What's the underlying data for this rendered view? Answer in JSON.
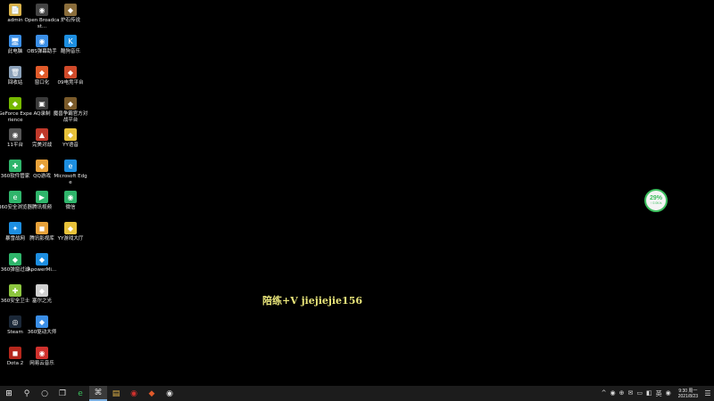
{
  "desktop": {
    "columns": [
      [
        {
          "name": "admin",
          "glyph": "📄",
          "color": "#d9b24a"
        },
        {
          "name": "此电脑",
          "glyph": "🖥",
          "color": "#3a8ee6"
        },
        {
          "name": "回收站",
          "glyph": "🗑",
          "color": "#8aa0b8"
        },
        {
          "name": "GeForce Experience",
          "glyph": "◆",
          "color": "#76b900"
        },
        {
          "name": "11平台",
          "glyph": "◉",
          "color": "#555555"
        },
        {
          "name": "360软件管家",
          "glyph": "✚",
          "color": "#2fb56b"
        },
        {
          "name": "360安全浏览器",
          "glyph": "e",
          "color": "#2fb56b"
        },
        {
          "name": "暴雪战网",
          "glyph": "✦",
          "color": "#1d8ee0"
        },
        {
          "name": "360弹窗过滤",
          "glyph": "◆",
          "color": "#2fb56b"
        },
        {
          "name": "360安全卫士",
          "glyph": "✚",
          "color": "#8cc63f"
        },
        {
          "name": "Steam",
          "glyph": "◎",
          "color": "#1b2838"
        },
        {
          "name": "Dota 2",
          "glyph": "◼",
          "color": "#b5271c"
        }
      ],
      [
        {
          "name": "Open Broadcast...",
          "glyph": "◉",
          "color": "#444444"
        },
        {
          "name": "OBS弹幕助手",
          "glyph": "◉",
          "color": "#3a8ee6"
        },
        {
          "name": "窗口化",
          "glyph": "◆",
          "color": "#e05a2a"
        },
        {
          "name": "AQ录制",
          "glyph": "▣",
          "color": "#3a3a3a"
        },
        {
          "name": "完美对战",
          "glyph": "▲",
          "color": "#c0392b"
        },
        {
          "name": "QQ游戏",
          "glyph": "◆",
          "color": "#e8a23a"
        },
        {
          "name": "腾讯视频",
          "glyph": "▶",
          "color": "#2fb56b"
        },
        {
          "name": "腾讯影视库",
          "glyph": "◼",
          "color": "#e8a23a"
        },
        {
          "name": "ApowerMi...",
          "glyph": "◆",
          "color": "#1d8ee0"
        },
        {
          "name": "塞尔之光",
          "glyph": "◆",
          "color": "#d0d0d0"
        },
        {
          "name": "360驱动大师",
          "glyph": "◆",
          "color": "#3a8ee6"
        },
        {
          "name": "网易云音乐",
          "glyph": "◉",
          "color": "#d0312d"
        }
      ],
      [
        {
          "name": "炉石传说",
          "glyph": "◆",
          "color": "#8a6d3b"
        },
        {
          "name": "酷狗音乐",
          "glyph": "K",
          "color": "#1d8ee0"
        },
        {
          "name": "09电竞平台",
          "glyph": "◆",
          "color": "#d04a2a"
        },
        {
          "name": "魔兽争霸官方对战平台",
          "glyph": "◆",
          "color": "#7a5a2a"
        },
        {
          "name": "YY语音",
          "glyph": "◆",
          "color": "#e8c23a"
        },
        {
          "name": "Microsoft Edge",
          "glyph": "e",
          "color": "#1d8ee0"
        },
        {
          "name": "微信",
          "glyph": "◉",
          "color": "#2fb56b"
        },
        {
          "name": "YY游戏大厅",
          "glyph": "◆",
          "color": "#e8c23a"
        }
      ]
    ]
  },
  "watermark": "陪练+V  jiejiejie156",
  "netmeter": {
    "percent": "29%",
    "speed": "↑ 0.0K/s"
  },
  "taskbar": {
    "start_glyph": "⊞",
    "search_glyph": "⚲",
    "cortana_glyph": "○",
    "taskview_glyph": "❐",
    "apps": [
      {
        "name": "360安全浏览器",
        "glyph": "e",
        "color": "#3cbf5e",
        "active": false
      },
      {
        "name": "鼠标",
        "glyph": "⌘",
        "color": "#dddddd",
        "active": true
      },
      {
        "name": "文件管理",
        "glyph": "▤",
        "color": "#e8b84a",
        "active": false
      },
      {
        "name": "网易云音乐",
        "glyph": "◉",
        "color": "#d0312d",
        "active": false
      },
      {
        "name": "窗口化",
        "glyph": "◆",
        "color": "#e05a2a",
        "active": false
      },
      {
        "name": "OBS",
        "glyph": "◉",
        "color": "#dddddd",
        "active": false
      }
    ],
    "tray": [
      "^",
      "◉",
      "⊕",
      "✉",
      "▭",
      "◧",
      "英",
      "◉"
    ],
    "time": "9:30 周一",
    "date": "2021/8/23",
    "notif_glyph": "☰"
  }
}
